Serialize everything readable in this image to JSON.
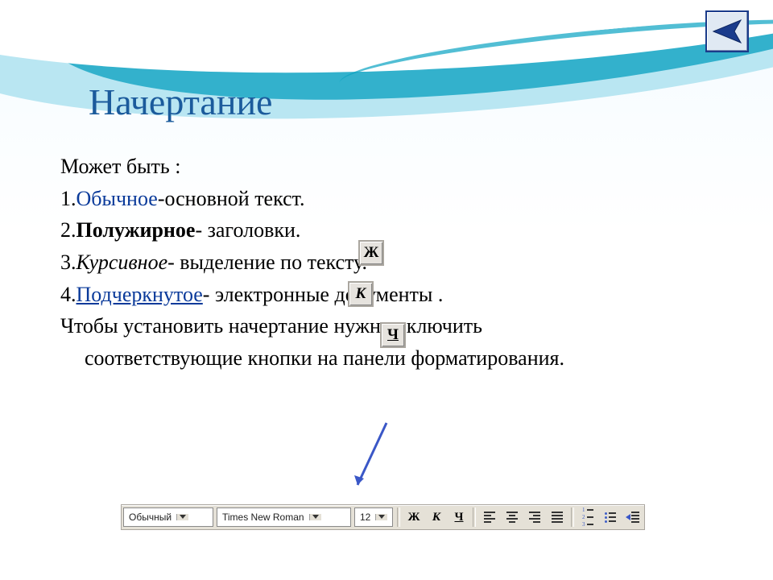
{
  "title": "Начертание",
  "intro": "Может быть :",
  "items": [
    {
      "num": "1.",
      "style_label": "Обычное",
      "rest": "-основной текст."
    },
    {
      "num": "2.",
      "style_label": "Полужирное",
      "rest": "- заголовки."
    },
    {
      "num": "3.",
      "style_label": "Курсивное",
      "rest": "- выделение по тексту."
    },
    {
      "num": "4.",
      "style_label": "Подчеркнутое",
      "rest": "- электронные документы ."
    }
  ],
  "note_line1": "Чтобы установить начертание нужно включить",
  "note_line2": "соответствующие кнопки на панели форматирования.",
  "float_buttons": {
    "bold": "Ж",
    "italic": "К",
    "underline": "Ч"
  },
  "toolbar": {
    "style_combo": "Обычный",
    "font_combo": "Times New Roman",
    "size_combo": "12",
    "bold": "Ж",
    "italic": "К",
    "underline": "Ч"
  }
}
